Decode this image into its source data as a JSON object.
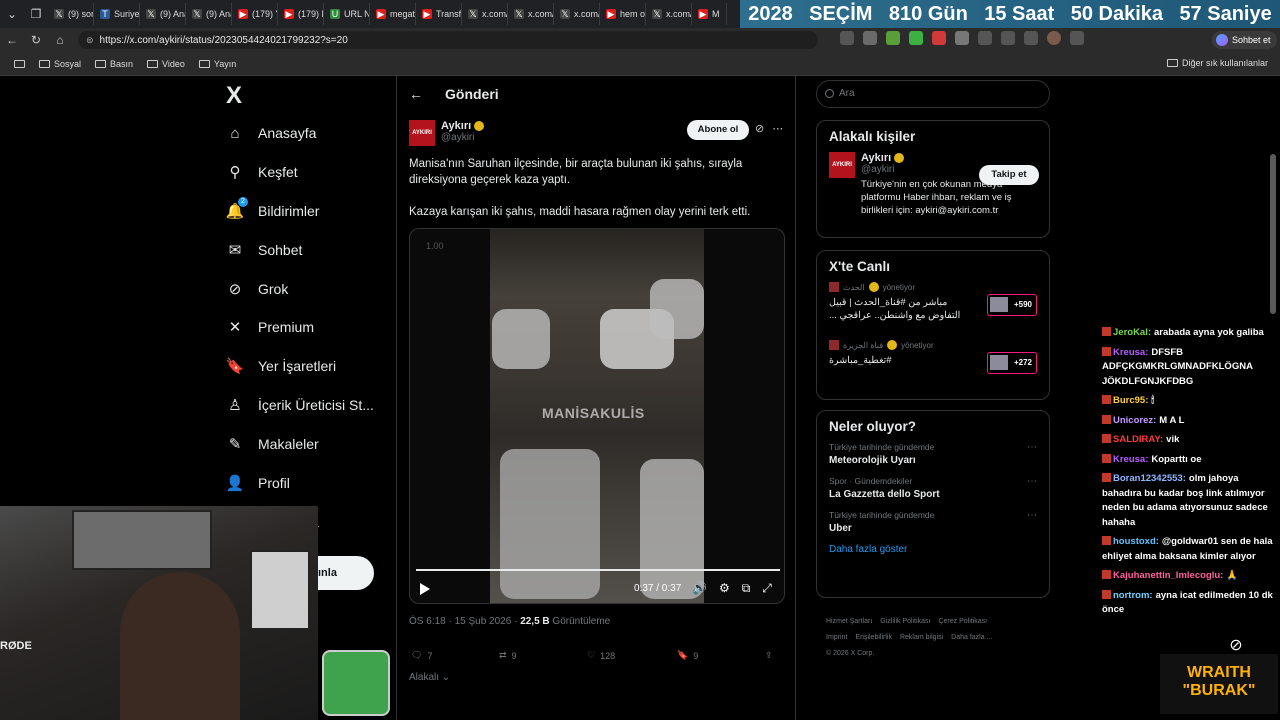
{
  "browser": {
    "tabs": [
      {
        "label": "(9) son",
        "icon": "x"
      },
      {
        "label": "Suriye",
        "icon": "ten"
      },
      {
        "label": "(9) Ana",
        "icon": "x"
      },
      {
        "label": "(9) Ana",
        "icon": "x"
      },
      {
        "label": "(179) Y",
        "icon": "yt"
      },
      {
        "label": "(179) E",
        "icon": "yt"
      },
      {
        "label": "URL N",
        "icon": "ext"
      },
      {
        "label": "megat",
        "icon": "yt"
      },
      {
        "label": "Transfe",
        "icon": "yt"
      },
      {
        "label": "x.com/",
        "icon": "x"
      },
      {
        "label": "x.com/",
        "icon": "x"
      },
      {
        "label": "x.com/",
        "icon": "x"
      },
      {
        "label": "hem o",
        "icon": "yt"
      },
      {
        "label": "x.com/",
        "icon": "x"
      },
      {
        "label": "M",
        "icon": "yt"
      }
    ],
    "url": "https://x.com/aykiri/status/2023054424021799232?s=20",
    "sohbet_label": "Sohbet et",
    "bookmarks": [
      "Sosyal",
      "Basın",
      "Video",
      "Yayın"
    ],
    "other_bookmarks": "Diğer sık kullanılanlar"
  },
  "countdown": {
    "year": "2028",
    "label": "SEÇİM",
    "days": "810 Gün",
    "hours": "15 Saat",
    "minutes": "50 Dakika",
    "seconds": "57 Saniye"
  },
  "sidebar": {
    "logo": "X",
    "items": [
      {
        "label": "Anasayfa",
        "icon": "home-icon",
        "glyph": "⌂"
      },
      {
        "label": "Keşfet",
        "icon": "search-icon",
        "glyph": "⚲"
      },
      {
        "label": "Bildirimler",
        "icon": "bell-icon",
        "glyph": "🔔",
        "badge": "2"
      },
      {
        "label": "Sohbet",
        "icon": "mail-icon",
        "glyph": "✉"
      },
      {
        "label": "Grok",
        "icon": "grok-icon",
        "glyph": "⊘"
      },
      {
        "label": "Premium",
        "icon": "x-icon",
        "glyph": "✕"
      },
      {
        "label": "Yer İşaretleri",
        "icon": "bookmark-icon",
        "glyph": "🔖"
      },
      {
        "label": "İçerik Üreticisi St...",
        "icon": "creator-icon",
        "glyph": "♙"
      },
      {
        "label": "Makaleler",
        "icon": "article-icon",
        "glyph": "✎"
      },
      {
        "label": "Profil",
        "icon": "profile-icon",
        "glyph": "👤"
      }
    ],
    "nav_fragment": "a",
    "post_fragment": "ınla"
  },
  "post": {
    "header_title": "Gönderi",
    "author_name": "Aykırı",
    "author_handle": "@aykiri",
    "avatar_text": "AYKIRI",
    "subscribe_label": "Abone ol",
    "text": [
      "Manisa'nın Saruhan ilçesinde, bir araçta bulunan iki şahıs, sırayla direksiyona geçerek kaza yaptı.",
      "Kazaya karışan iki şahıs, maddi hasara rağmen olay yerini terk etti."
    ],
    "video": {
      "speed": "1.00",
      "watermark": "MANİSAKULİS",
      "time": "0:37 / 0:37",
      "progress": 1.0
    },
    "time": "ÖS 6:18 · 15 Şub 2026 · ",
    "views": "22,5 B",
    "views_label": " Görüntüleme",
    "replies": "7",
    "reposts": "9",
    "likes": "128",
    "bookmarks": "9",
    "related": "Alakalı"
  },
  "right": {
    "search_placeholder": "Ara",
    "related_title": "Alakalı kişiler",
    "person_name": "Aykırı",
    "person_handle": "@aykiri",
    "follow_label": "Takip et",
    "person_bio": "Türkiye'nin en çok okunan medya platformu Haber ihbarı, reklam ve iş birlikleri için: aykiri@aykiri.com.tr",
    "live_title": "X'te Canlı",
    "live": [
      {
        "source": "الحدث",
        "status": "yönetiyor",
        "text": "مباشر من #قناة_الحدث | قبيل التفاوض مع واشنطن.. عراقجي ...",
        "count": "+590"
      },
      {
        "source": "قناة الجزيرة",
        "status": "yönetiyor",
        "text": "#تغطية_مباشرة",
        "count": "+272"
      }
    ],
    "trends_title": "Neler oluyor?",
    "trends": [
      {
        "cat": "Türkiye tarihinde gündemde",
        "name": "Meteorolojik Uyarı"
      },
      {
        "cat": "Spor · Gündemdekiler",
        "name": "La Gazzetta dello Sport"
      },
      {
        "cat": "Türkiye tarihinde gündemde",
        "name": "Uber"
      }
    ],
    "show_more": "Daha fazla göster",
    "footer": [
      "Hizmet Şartları",
      "Gizlilik Politikası",
      "Çerez Politikası",
      "Imprint",
      "Erişilebilirlik",
      "Reklam bilgisi",
      "Daha fazla ...",
      "© 2026 X Corp."
    ]
  },
  "chat": [
    {
      "user": "JeroKal:",
      "color": "#7bd84a",
      "text": "arabada ayna yok galiba"
    },
    {
      "user": "Kreusa:",
      "color": "#b75cff",
      "text": "DFSFB ADFÇKGMKRLGMNADFKLÖGNA JÖKDLFGNJKFDBG"
    },
    {
      "user": "Burc95:",
      "color": "#ffd23f",
      "text": "🕯"
    },
    {
      "user": "Unicorez:",
      "color": "#c59bff",
      "text": "M A L"
    },
    {
      "user": "SALDIRAY:",
      "color": "#ff3b3b",
      "text": "vik"
    },
    {
      "user": "Kreusa:",
      "color": "#b75cff",
      "text": "Koparttı oe"
    },
    {
      "user": "Boran12342553:",
      "color": "#8fb8ff",
      "text": "olm jahoya bahadıra bu kadar boş link atılmıyor neden bu adama atıyorsunuz sadece hahaha"
    },
    {
      "user": "houstoxd:",
      "color": "#5fc3ff",
      "text": "@goldwar01 sen de hala ehliyet alma baksana kimler alıyor"
    },
    {
      "user": "Kajuhanettin_Imlecoglu:",
      "color": "#ff5fa0",
      "text": "🙏"
    },
    {
      "user": "nortrom:",
      "color": "#6fd3ff",
      "text": "ayna icat edilmeden 10 dk önce"
    }
  ],
  "overlay": {
    "brand_line1": "WRAITH",
    "brand_line2": "\"BURAK\"",
    "mic_text": "RØDE"
  }
}
